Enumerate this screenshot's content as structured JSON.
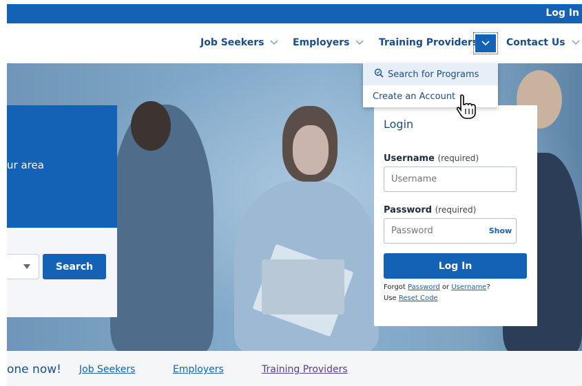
{
  "topbar": {
    "login_label": "Log In"
  },
  "nav": {
    "items": [
      {
        "label": "Job Seekers"
      },
      {
        "label": "Employers"
      },
      {
        "label": "Training Providers"
      },
      {
        "label": "Contact Us"
      }
    ]
  },
  "dropdown": {
    "items": [
      {
        "label": "Search for Programs",
        "icon": "search-icon"
      },
      {
        "label": "Create an Account"
      }
    ]
  },
  "search_panel": {
    "tagline": "ur area",
    "search_label": "Search"
  },
  "login": {
    "title": "Login",
    "username_label": "Username",
    "username_required": "(required)",
    "username_placeholder": "Username",
    "password_label": "Password",
    "password_required": "(required)",
    "password_placeholder": "Password",
    "show_label": "Show",
    "submit_label": "Log In",
    "forgot_prefix": "Forgot",
    "forgot_password": "Password",
    "forgot_or": "or",
    "forgot_username": "Username",
    "forgot_suffix": "?",
    "use_prefix": "Use",
    "reset_code": "Reset Code"
  },
  "bottom": {
    "cta": "one now!",
    "links": [
      "Job Seekers",
      "Employers",
      "Training Providers"
    ]
  },
  "colors": {
    "primary": "#1462b5",
    "nav_text": "#1a4e8a",
    "visited_link": "#5b3b8e"
  }
}
